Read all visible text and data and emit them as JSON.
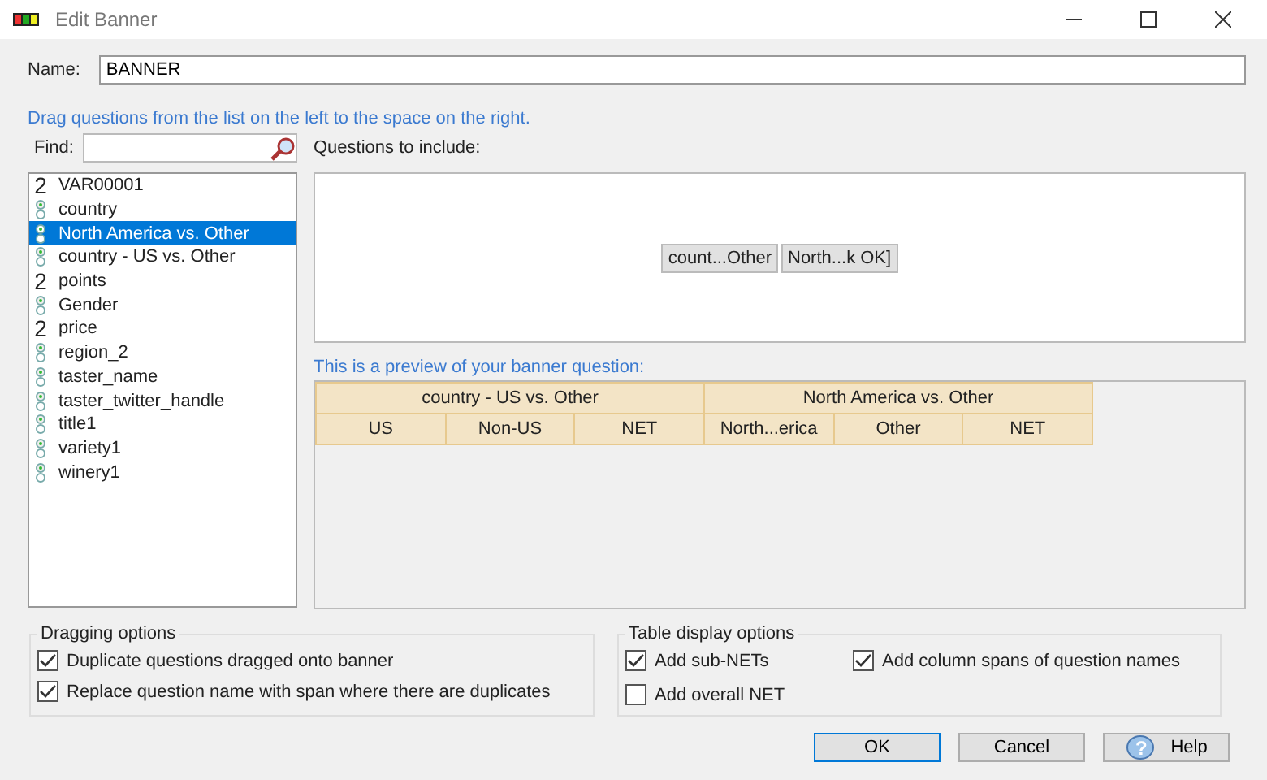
{
  "window": {
    "title": "Edit Banner"
  },
  "name_field": {
    "label": "Name:",
    "value": "BANNER"
  },
  "hint": "Drag questions from the list on the left to the space on the right.",
  "find": {
    "label": "Find:"
  },
  "questions": [
    {
      "label": "VAR00001",
      "kind": "numeric",
      "icon": "2",
      "selected": false
    },
    {
      "label": "country",
      "kind": "categorical",
      "selected": false
    },
    {
      "label": "North America vs. Other",
      "kind": "categorical",
      "selected": true
    },
    {
      "label": "country - US vs. Other",
      "kind": "categorical",
      "selected": false
    },
    {
      "label": "points",
      "kind": "numeric",
      "icon": "2",
      "selected": false
    },
    {
      "label": "Gender",
      "kind": "categorical",
      "selected": false
    },
    {
      "label": "price",
      "kind": "numeric",
      "icon": "2",
      "selected": false
    },
    {
      "label": "region_2",
      "kind": "categorical",
      "selected": false
    },
    {
      "label": "taster_name",
      "kind": "categorical",
      "selected": false
    },
    {
      "label": "taster_twitter_handle",
      "kind": "categorical",
      "selected": false
    },
    {
      "label": "title1",
      "kind": "categorical",
      "selected": false
    },
    {
      "label": "variety1",
      "kind": "categorical",
      "selected": false
    },
    {
      "label": "winery1",
      "kind": "categorical",
      "selected": false
    }
  ],
  "include": {
    "label": "Questions to include:",
    "chips": [
      "count...Other",
      "North...k OK]"
    ]
  },
  "preview": {
    "label": "This is a preview of your banner question:",
    "groups": [
      {
        "title": "country - US vs. Other",
        "columns": [
          "US",
          "Non-US",
          "NET"
        ]
      },
      {
        "title": "North America vs. Other",
        "columns": [
          "North...erica",
          "Other",
          "NET"
        ]
      }
    ]
  },
  "dragging_options": {
    "title": "Dragging options",
    "options": [
      {
        "label": "Duplicate questions dragged onto banner",
        "checked": true
      },
      {
        "label": "Replace question name with span where there are duplicates",
        "checked": true
      }
    ]
  },
  "table_display_options": {
    "title": "Table display options",
    "options": [
      {
        "label": "Add sub-NETs",
        "checked": true
      },
      {
        "label": "Add column spans of question names",
        "checked": true
      },
      {
        "label": "Add overall NET",
        "checked": false
      }
    ]
  },
  "buttons": [
    {
      "label": "OK",
      "kind": "default"
    },
    {
      "label": "Cancel",
      "kind": "plain"
    },
    {
      "label": "Help",
      "kind": "help",
      "icon": "?"
    }
  ]
}
